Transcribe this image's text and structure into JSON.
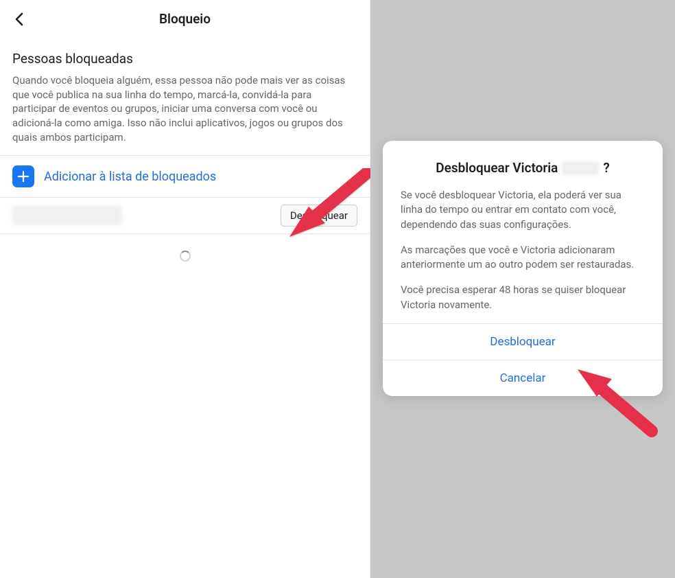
{
  "left": {
    "header_title": "Bloqueio",
    "section_title": "Pessoas bloqueadas",
    "section_desc": "Quando você bloqueia alguém, essa pessoa não pode mais ver as coisas que você publica na sua linha do tempo, marcá-la, convidá-la para participar de eventos ou grupos, iniciar uma conversa com você ou adicioná-la como amiga. Isso não inclui aplicativos, jogos ou grupos dos quais ambos participam.",
    "add_label": "Adicionar à lista de bloqueados",
    "unblock_button": "Desbloquear"
  },
  "right": {
    "modal_title_prefix": "Desbloquear Victoria",
    "modal_title_suffix": "?",
    "para1": "Se você desbloquear Victoria, ela poderá ver sua linha do tempo ou entrar em contato com você, dependendo das suas configurações.",
    "para2": "As marcações que você e Victoria adicionaram anteriormente um ao outro podem ser restauradas.",
    "para3": "Você precisa esperar 48 horas se quiser bloquear Victoria novamente.",
    "confirm_label": "Desbloquear",
    "cancel_label": "Cancelar"
  },
  "colors": {
    "accent": "#1877f2",
    "link": "#216fdb",
    "muted": "#65676b"
  }
}
